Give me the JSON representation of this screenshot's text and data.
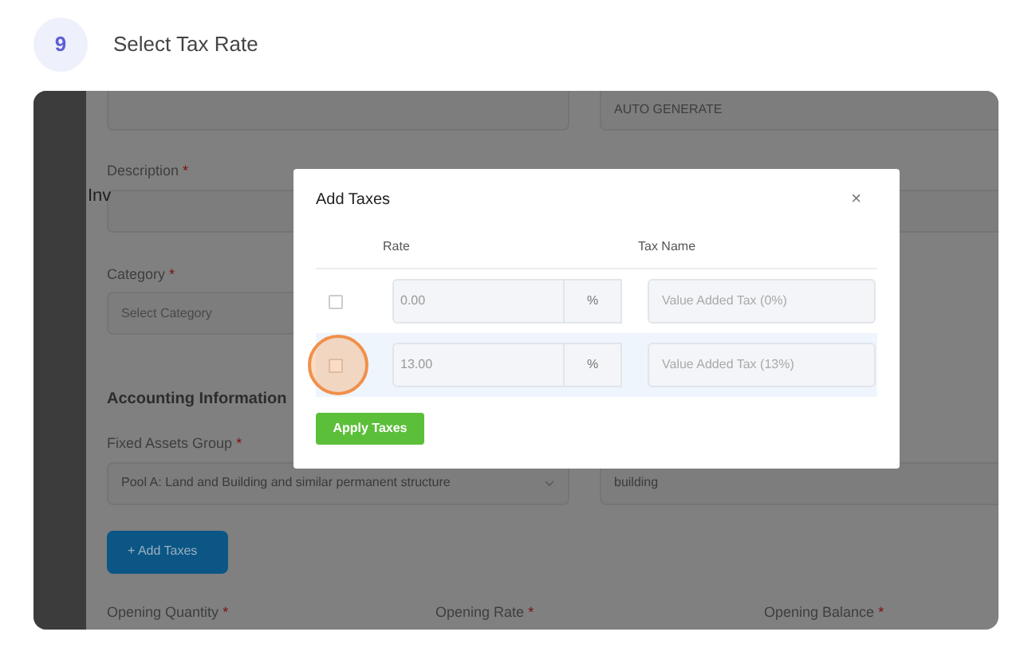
{
  "step": {
    "number": "9",
    "title": "Select Tax Rate"
  },
  "form": {
    "top_right_value": "AUTO GENERATE",
    "sidebar_text": "Inv",
    "description_label": "Description",
    "category_label": "Category",
    "category_placeholder": "Select Category",
    "section_title": "Accounting Information",
    "fixed_assets_label": "Fixed Assets Group",
    "fixed_assets_value": "Pool A: Land and Building and similar permanent structure",
    "right_value": "building",
    "add_taxes_button": "+ Add Taxes",
    "bottom_labels": [
      "Opening Quantity",
      "Opening Rate",
      "Opening Balance"
    ],
    "required_mark": "*"
  },
  "modal": {
    "title": "Add Taxes",
    "close": "×",
    "columns": [
      "Rate",
      "Tax Name"
    ],
    "rows": [
      {
        "checked": false,
        "highlighted": false,
        "annotated": false,
        "rate": "0.00",
        "unit": "%",
        "tax_name": "Value Added Tax (0%)"
      },
      {
        "checked": false,
        "highlighted": true,
        "annotated": true,
        "rate": "13.00",
        "unit": "%",
        "tax_name": "Value Added Tax (13%)"
      }
    ],
    "apply_button": "Apply Taxes"
  }
}
